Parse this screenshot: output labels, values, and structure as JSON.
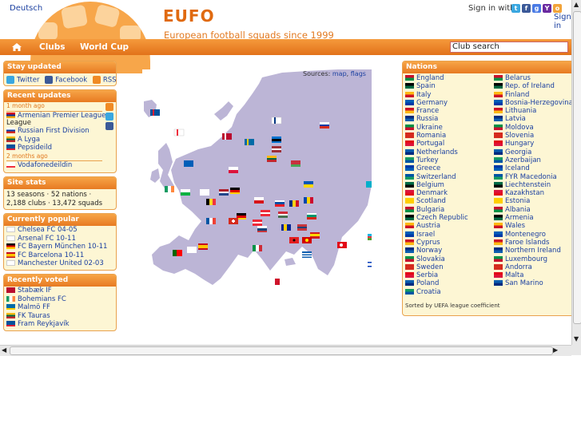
{
  "header": {
    "language_link": "Deutsch",
    "logo": "EUFO",
    "tagline": "European football squads since 1999",
    "signin_label": "Sign in with",
    "signin_link": "Sign in"
  },
  "nav": {
    "items": [
      "Clubs",
      "World Cup"
    ],
    "search_value": "Club search"
  },
  "stay_updated": {
    "title": "Stay updated",
    "links": [
      "Twitter",
      "Facebook",
      "RSS"
    ]
  },
  "recent_updates": {
    "title": "Recent updates",
    "time1": "1 month ago",
    "items1": [
      "Armenian Premier League",
      "Russian First Division",
      "A Lyga",
      "Pepsideild"
    ],
    "time2": "2 months ago",
    "items2": [
      "Vodafonedeildin"
    ]
  },
  "site_stats": {
    "title": "Site stats",
    "line1": "13 seasons · 52 nations ·",
    "line2": "2,188 clubs · 13,472 squads"
  },
  "currently_popular": {
    "title": "Currently popular",
    "items": [
      "Chelsea FC 04-05",
      "Arsenal FC 10-11",
      "FC Bayern München 10-11",
      "FC Barcelona 10-11",
      "Manchester United 02-03"
    ]
  },
  "recently_voted": {
    "title": "Recently voted",
    "items": [
      "Stabæk IF",
      "Bohemians FC",
      "Malmö FF",
      "FK Tauras",
      "Fram Reykjavík"
    ]
  },
  "map": {
    "sources_label": "Sources:",
    "map_link": "map",
    "flags_link": "flags"
  },
  "nations": {
    "title": "Nations",
    "col1": [
      "England",
      "Spain",
      "Italy",
      "Germany",
      "France",
      "Russia",
      "Ukraine",
      "Romania",
      "Portugal",
      "Netherlands",
      "Turkey",
      "Greece",
      "Switzerland",
      "Belgium",
      "Denmark",
      "Scotland",
      "Bulgaria",
      "Czech Republic",
      "Austria",
      "Israel",
      "Cyprus",
      "Norway",
      "Slovakia",
      "Sweden",
      "Serbia",
      "Poland",
      "Croatia"
    ],
    "col2": [
      "Belarus",
      "Rep. of Ireland",
      "Finland",
      "Bosnia-Herzegovina",
      "Lithuania",
      "Latvia",
      "Moldova",
      "Slovenia",
      "Hungary",
      "Georgia",
      "Azerbaijan",
      "Iceland",
      "FYR Macedonia",
      "Liechtenstein",
      "Kazakhstan",
      "Estonia",
      "Albania",
      "Armenia",
      "Wales",
      "Montenegro",
      "Faroe Islands",
      "Northern Ireland",
      "Luxembourg",
      "Andorra",
      "Malta",
      "San Marino"
    ],
    "sorted_note": "Sorted by UEFA league coefficient"
  },
  "colors": {
    "accent": "#e2721a",
    "panel": "#fdf6d4",
    "map_land": "#bdb6d7",
    "link": "#1a3fa0"
  }
}
